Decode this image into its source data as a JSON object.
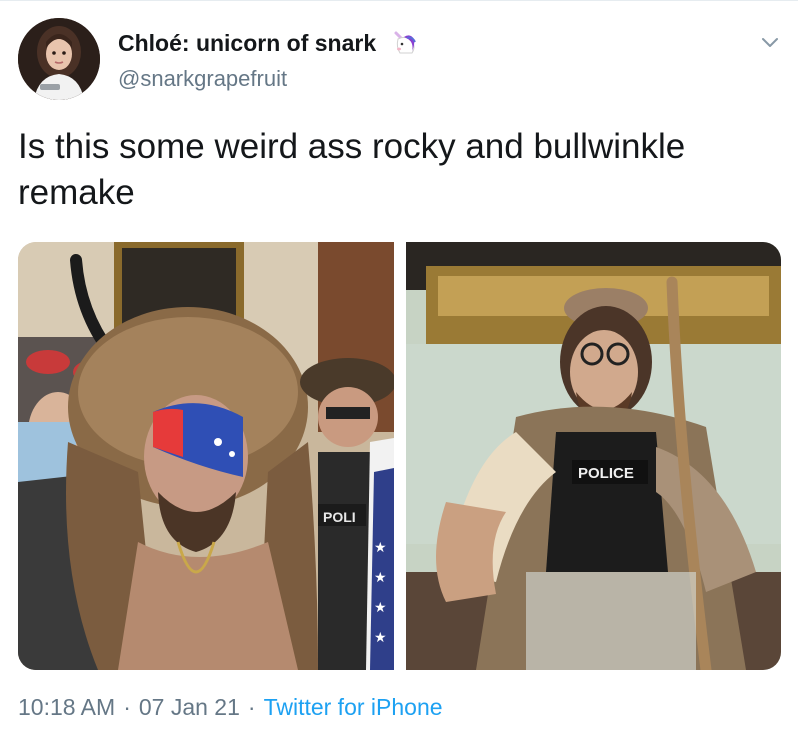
{
  "tweet": {
    "author": {
      "display_name": "Chloé: unicorn of snark",
      "name_emoji": "unicorn-icon",
      "handle": "@snarkgrapefruit"
    },
    "text": "Is this some weird ass rocky and bullwinkle remake",
    "media": [
      {
        "kind": "photo",
        "badge_text": "POLI"
      },
      {
        "kind": "photo",
        "badge_text": "POLICE"
      }
    ],
    "time": "10:18 AM",
    "dot1": "·",
    "date": "07 Jan 21",
    "dot2": "·",
    "source": "Twitter for iPhone"
  },
  "colors": {
    "text_primary": "#14171a",
    "text_secondary": "#657786",
    "link": "#1da1f2"
  }
}
